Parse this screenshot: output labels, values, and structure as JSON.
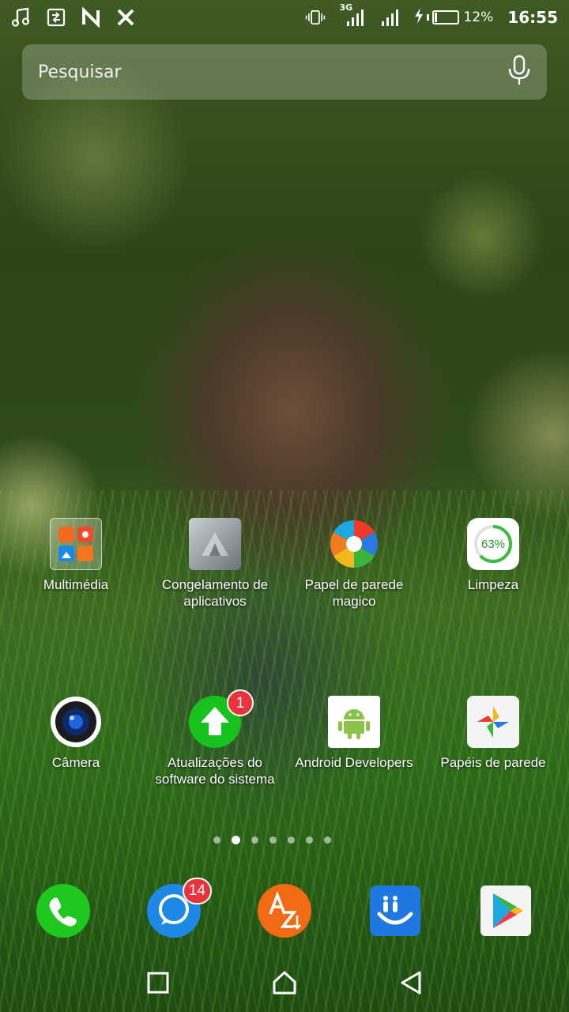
{
  "status_bar": {
    "left_icons": [
      "music-icon",
      "screen-transfer-icon",
      "nfc-n-icon",
      "x-app-icon"
    ],
    "right_icons": [
      "vibrate-icon",
      "signal-3g-icon",
      "signal-icon",
      "charging-icon"
    ],
    "network_label": "3G",
    "battery_percent": "12%",
    "battery_level": 0.12,
    "time": "16:55"
  },
  "search": {
    "placeholder": "Pesquisar"
  },
  "apps_row1": [
    {
      "label": "Multimédia"
    },
    {
      "label": "Congelamento de aplicativos"
    },
    {
      "label": "Papel de parede magico"
    },
    {
      "label": "Limpeza",
      "icon_text": "63%",
      "level": 0.63
    }
  ],
  "apps_row2": [
    {
      "label": "Câmera"
    },
    {
      "label": "Atualizações do software do sistema",
      "badge": "1"
    },
    {
      "label": "Android Developers"
    },
    {
      "label": "Papéis de parede"
    }
  ],
  "dock": [
    {
      "name": "phone",
      "color": "#1ec81e"
    },
    {
      "name": "messages",
      "color": "#1e88e5",
      "badge": "14"
    },
    {
      "name": "translate-az",
      "color": "#f26a14"
    },
    {
      "name": "keyboard",
      "color": "#1e78e0"
    },
    {
      "name": "play-store",
      "color": "#ffffff"
    }
  ],
  "pages": {
    "count": 7,
    "active_index": 1
  },
  "colors": {
    "badge": "#e8333c",
    "update_green": "#18c21e",
    "clean_green": "#3cbb3c"
  }
}
